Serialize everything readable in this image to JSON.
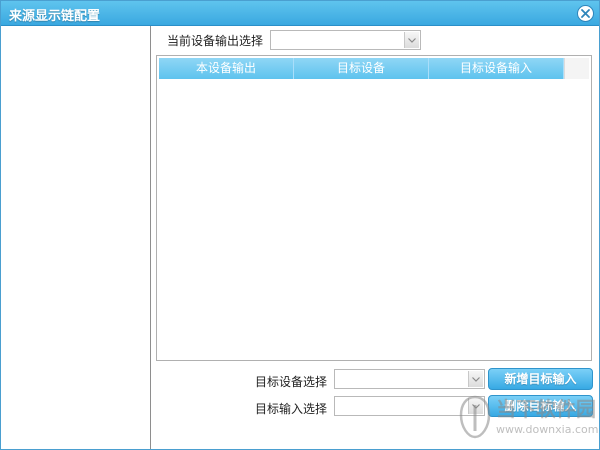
{
  "window": {
    "title": "来源显示链配置",
    "accent": "#3aa8e0"
  },
  "top": {
    "output_label": "当前设备输出选择",
    "output_value": ""
  },
  "table": {
    "columns": [
      "本设备输出",
      "目标设备",
      "目标设备输入"
    ],
    "rows": []
  },
  "form": {
    "target_device_label": "目标设备选择",
    "target_device_value": "",
    "target_input_label": "目标输入选择",
    "target_input_value": ""
  },
  "buttons": {
    "add_label": "新增目标输入",
    "delete_label": "删除目标输入"
  },
  "watermark": {
    "text": "当下软件园",
    "url": "www.downxia.com"
  },
  "icons": {
    "close": "close-icon",
    "dropdown": "chevron-down-icon"
  }
}
